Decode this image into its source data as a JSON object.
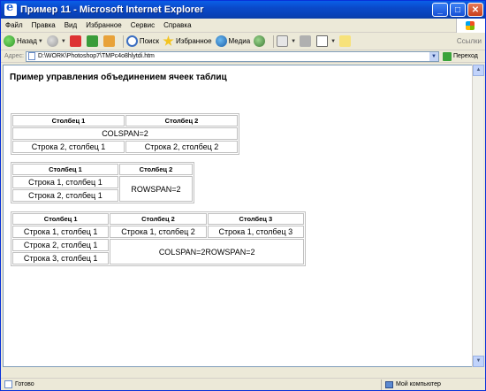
{
  "window": {
    "title": "Пример 11 - Microsoft Internet Explorer"
  },
  "menu": [
    "Файл",
    "Правка",
    "Вид",
    "Избранное",
    "Сервис",
    "Справка"
  ],
  "toolbar": {
    "back_label": "Назад",
    "search_label": "Поиск",
    "favorites_label": "Избранное",
    "media_label": "Медиа",
    "links_label": "Ссылки"
  },
  "address": {
    "label": "Адрес:",
    "url": "D:\\WORK\\Photoshop7\\TMPc4o8hlytdi.htm",
    "go_label": "Переход"
  },
  "page": {
    "heading": "Пример управления объединением ячеек таблиц",
    "table1": {
      "headers": [
        "Столбец 1",
        "Столбец 2"
      ],
      "colspan_cell": "COLSPAN=2",
      "row2": [
        "Строка 2, столбец 1",
        "Строка 2, столбец 2"
      ]
    },
    "table2": {
      "headers": [
        "Столбец 1",
        "Столбец 2"
      ],
      "row1_col1": "Строка 1, столбец 1",
      "rowspan_cell": "ROWSPAN=2",
      "row2_col1": "Строка 2, столбец 1"
    },
    "table3": {
      "headers": [
        "Столбец 1",
        "Столбец 2",
        "Столбец 3"
      ],
      "row1": [
        "Строка 1, столбец 1",
        "Строка 1, столбец 2",
        "Строка 1, столбец 3"
      ],
      "row2_col1": "Строка 2, столбец 1",
      "span_cell": "COLSPAN=2ROWSPAN=2",
      "row3_col1": "Строка 3, столбец 1"
    }
  },
  "status": {
    "text": "Готово",
    "zone": "Мой компьютер"
  }
}
